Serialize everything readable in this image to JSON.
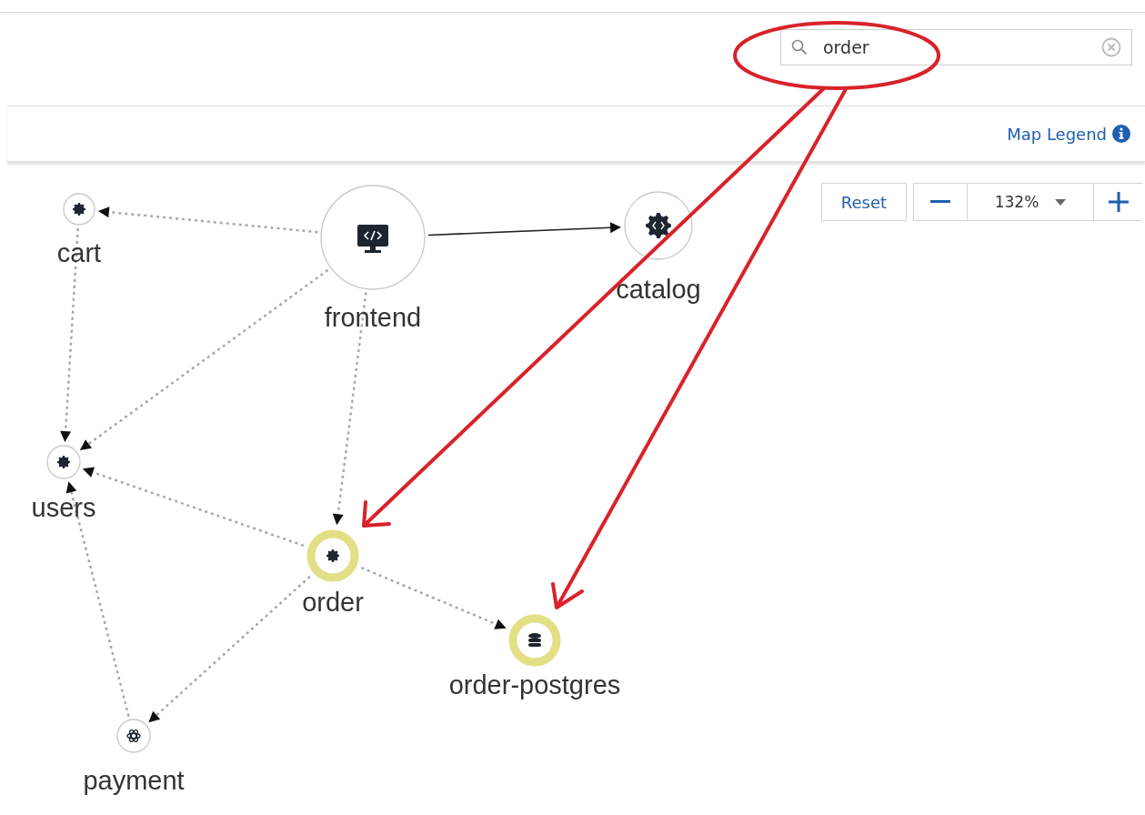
{
  "search": {
    "value": "order"
  },
  "map_legend": {
    "label": "Map Legend"
  },
  "zoom": {
    "reset_label": "Reset",
    "value": "132%"
  },
  "nodes": [
    {
      "label": "cart",
      "kind": "service",
      "highlighted": false
    },
    {
      "label": "frontend",
      "kind": "frontend",
      "highlighted": false
    },
    {
      "label": "catalog",
      "kind": "code-service",
      "highlighted": false
    },
    {
      "label": "users",
      "kind": "service",
      "highlighted": false
    },
    {
      "label": "order",
      "kind": "service",
      "highlighted": true
    },
    {
      "label": "order-postgres",
      "kind": "database",
      "highlighted": true
    },
    {
      "label": "payment",
      "kind": "payment",
      "highlighted": false
    }
  ],
  "edges": [
    {
      "dashed": true
    },
    {
      "dashed": false
    },
    {
      "dashed": true
    },
    {
      "dashed": true
    },
    {
      "dashed": true
    },
    {
      "dashed": true
    },
    {
      "dashed": true
    },
    {
      "dashed": true
    },
    {
      "dashed": true
    }
  ]
}
